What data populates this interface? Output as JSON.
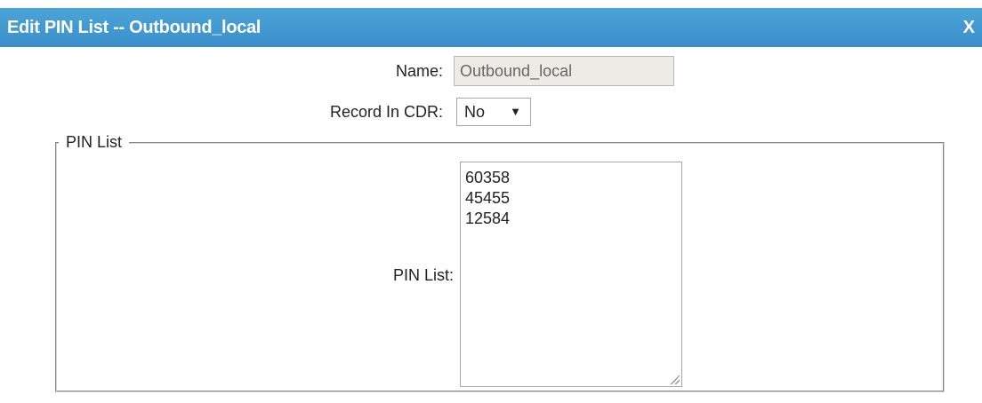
{
  "dialog": {
    "title": "Edit PIN List -- Outbound_local",
    "close_label": "X"
  },
  "form": {
    "name_label": "Name:",
    "name_value": "Outbound_local",
    "record_cdr_label": "Record In CDR:",
    "record_cdr_value": "No",
    "record_cdr_arrow": "▼"
  },
  "pin_group": {
    "legend": "PIN List",
    "field_label": "PIN List:",
    "pins": [
      "60358",
      "45455",
      "12584"
    ]
  }
}
